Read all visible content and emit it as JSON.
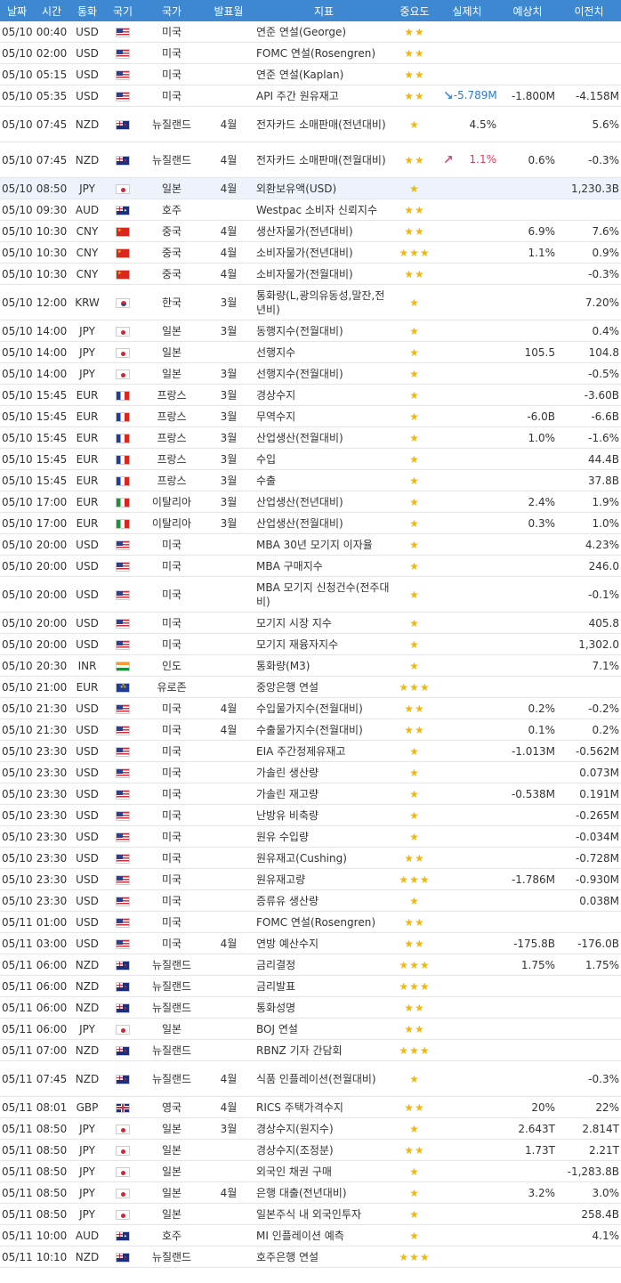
{
  "headers": [
    "날짜",
    "시간",
    "통화",
    "국기",
    "국가",
    "발표월",
    "지표",
    "중요도",
    "실제치",
    "예상치",
    "이전치"
  ],
  "rows": [
    {
      "date": "05/10",
      "time": "00:40",
      "cur": "USD",
      "flag": "us",
      "country": "미국",
      "month": "",
      "ind": "연준 연설(George)",
      "stars": "★★",
      "arrow": "",
      "actual": "",
      "actual_dir": "",
      "forecast": "",
      "prev": ""
    },
    {
      "date": "05/10",
      "time": "02:00",
      "cur": "USD",
      "flag": "us",
      "country": "미국",
      "month": "",
      "ind": "FOMC 연설(Rosengren)",
      "stars": "★★",
      "arrow": "",
      "actual": "",
      "actual_dir": "",
      "forecast": "",
      "prev": ""
    },
    {
      "date": "05/10",
      "time": "05:15",
      "cur": "USD",
      "flag": "us",
      "country": "미국",
      "month": "",
      "ind": "연준 연설(Kaplan)",
      "stars": "★★",
      "arrow": "",
      "actual": "",
      "actual_dir": "",
      "forecast": "",
      "prev": ""
    },
    {
      "date": "05/10",
      "time": "05:35",
      "cur": "USD",
      "flag": "us",
      "country": "미국",
      "month": "",
      "ind": "API 주간 원유재고",
      "stars": "★★",
      "arrow": "down",
      "actual": "-5.789M",
      "actual_dir": "neg",
      "forecast": "-1.800M",
      "prev": "-4.158M"
    },
    {
      "date": "05/10",
      "time": "07:45",
      "cur": "NZD",
      "flag": "nz",
      "country": "뉴질랜드",
      "month": "4월",
      "ind": "전자카드 소매판매(전년대비)",
      "stars": "★",
      "arrow": "",
      "actual": "4.5%",
      "actual_dir": "",
      "forecast": "",
      "prev": "5.6%",
      "tall": true
    },
    {
      "date": "05/10",
      "time": "07:45",
      "cur": "NZD",
      "flag": "nz",
      "country": "뉴질랜드",
      "month": "4월",
      "ind": "전자카드 소매판매(전월대비)",
      "stars": "★★",
      "arrow": "up",
      "actual": "1.1%",
      "actual_dir": "pos",
      "forecast": "0.6%",
      "prev": "-0.3%",
      "tall": true
    },
    {
      "date": "05/10",
      "time": "08:50",
      "cur": "JPY",
      "flag": "jp",
      "country": "일본",
      "month": "4월",
      "ind": "외환보유액(USD)",
      "stars": "★",
      "arrow": "",
      "actual": "",
      "actual_dir": "",
      "forecast": "",
      "prev": "1,230.3B",
      "hl": true
    },
    {
      "date": "05/10",
      "time": "09:30",
      "cur": "AUD",
      "flag": "au",
      "country": "호주",
      "month": "",
      "ind": "Westpac 소비자 신뢰지수",
      "stars": "★★",
      "arrow": "",
      "actual": "",
      "actual_dir": "",
      "forecast": "",
      "prev": ""
    },
    {
      "date": "05/10",
      "time": "10:30",
      "cur": "CNY",
      "flag": "cn",
      "country": "중국",
      "month": "4월",
      "ind": "생산자물가(전년대비)",
      "stars": "★★",
      "arrow": "",
      "actual": "",
      "actual_dir": "",
      "forecast": "6.9%",
      "prev": "7.6%"
    },
    {
      "date": "05/10",
      "time": "10:30",
      "cur": "CNY",
      "flag": "cn",
      "country": "중국",
      "month": "4월",
      "ind": "소비자물가(전년대비)",
      "stars": "★★★",
      "arrow": "",
      "actual": "",
      "actual_dir": "",
      "forecast": "1.1%",
      "prev": "0.9%"
    },
    {
      "date": "05/10",
      "time": "10:30",
      "cur": "CNY",
      "flag": "cn",
      "country": "중국",
      "month": "4월",
      "ind": "소비자물가(전월대비)",
      "stars": "★★",
      "arrow": "",
      "actual": "",
      "actual_dir": "",
      "forecast": "",
      "prev": "-0.3%"
    },
    {
      "date": "05/10",
      "time": "12:00",
      "cur": "KRW",
      "flag": "kr",
      "country": "한국",
      "month": "3월",
      "ind": "통화량(L,광의유동성,말잔,전년비)",
      "stars": "★",
      "arrow": "",
      "actual": "",
      "actual_dir": "",
      "forecast": "",
      "prev": "7.20%",
      "tall": true
    },
    {
      "date": "05/10",
      "time": "14:00",
      "cur": "JPY",
      "flag": "jp",
      "country": "일본",
      "month": "3월",
      "ind": "동행지수(전월대비)",
      "stars": "★",
      "arrow": "",
      "actual": "",
      "actual_dir": "",
      "forecast": "",
      "prev": "0.4%"
    },
    {
      "date": "05/10",
      "time": "14:00",
      "cur": "JPY",
      "flag": "jp",
      "country": "일본",
      "month": "",
      "ind": "선행지수",
      "stars": "★",
      "arrow": "",
      "actual": "",
      "actual_dir": "",
      "forecast": "105.5",
      "prev": "104.8"
    },
    {
      "date": "05/10",
      "time": "14:00",
      "cur": "JPY",
      "flag": "jp",
      "country": "일본",
      "month": "3월",
      "ind": "선행지수(전월대비)",
      "stars": "★",
      "arrow": "",
      "actual": "",
      "actual_dir": "",
      "forecast": "",
      "prev": "-0.5%"
    },
    {
      "date": "05/10",
      "time": "15:45",
      "cur": "EUR",
      "flag": "fr",
      "country": "프랑스",
      "month": "3월",
      "ind": "경상수지",
      "stars": "★",
      "arrow": "",
      "actual": "",
      "actual_dir": "",
      "forecast": "",
      "prev": "-3.60B"
    },
    {
      "date": "05/10",
      "time": "15:45",
      "cur": "EUR",
      "flag": "fr",
      "country": "프랑스",
      "month": "3월",
      "ind": "무역수지",
      "stars": "★",
      "arrow": "",
      "actual": "",
      "actual_dir": "",
      "forecast": "-6.0B",
      "prev": "-6.6B"
    },
    {
      "date": "05/10",
      "time": "15:45",
      "cur": "EUR",
      "flag": "fr",
      "country": "프랑스",
      "month": "3월",
      "ind": "산업생산(전월대비)",
      "stars": "★",
      "arrow": "",
      "actual": "",
      "actual_dir": "",
      "forecast": "1.0%",
      "prev": "-1.6%"
    },
    {
      "date": "05/10",
      "time": "15:45",
      "cur": "EUR",
      "flag": "fr",
      "country": "프랑스",
      "month": "3월",
      "ind": "수입",
      "stars": "★",
      "arrow": "",
      "actual": "",
      "actual_dir": "",
      "forecast": "",
      "prev": "44.4B"
    },
    {
      "date": "05/10",
      "time": "15:45",
      "cur": "EUR",
      "flag": "fr",
      "country": "프랑스",
      "month": "3월",
      "ind": "수출",
      "stars": "★",
      "arrow": "",
      "actual": "",
      "actual_dir": "",
      "forecast": "",
      "prev": "37.8B"
    },
    {
      "date": "05/10",
      "time": "17:00",
      "cur": "EUR",
      "flag": "it",
      "country": "이탈리아",
      "month": "3월",
      "ind": "산업생산(전년대비)",
      "stars": "★",
      "arrow": "",
      "actual": "",
      "actual_dir": "",
      "forecast": "2.4%",
      "prev": "1.9%"
    },
    {
      "date": "05/10",
      "time": "17:00",
      "cur": "EUR",
      "flag": "it",
      "country": "이탈리아",
      "month": "3월",
      "ind": "산업생산(전월대비)",
      "stars": "★",
      "arrow": "",
      "actual": "",
      "actual_dir": "",
      "forecast": "0.3%",
      "prev": "1.0%"
    },
    {
      "date": "05/10",
      "time": "20:00",
      "cur": "USD",
      "flag": "us",
      "country": "미국",
      "month": "",
      "ind": "MBA 30년 모기지 이자율",
      "stars": "★",
      "arrow": "",
      "actual": "",
      "actual_dir": "",
      "forecast": "",
      "prev": "4.23%"
    },
    {
      "date": "05/10",
      "time": "20:00",
      "cur": "USD",
      "flag": "us",
      "country": "미국",
      "month": "",
      "ind": "MBA 구매지수",
      "stars": "★",
      "arrow": "",
      "actual": "",
      "actual_dir": "",
      "forecast": "",
      "prev": "246.0"
    },
    {
      "date": "05/10",
      "time": "20:00",
      "cur": "USD",
      "flag": "us",
      "country": "미국",
      "month": "",
      "ind": "MBA 모기지 신청건수(전주대비)",
      "stars": "★",
      "arrow": "",
      "actual": "",
      "actual_dir": "",
      "forecast": "",
      "prev": "-0.1%",
      "tall": true
    },
    {
      "date": "05/10",
      "time": "20:00",
      "cur": "USD",
      "flag": "us",
      "country": "미국",
      "month": "",
      "ind": "모기지 시장 지수",
      "stars": "★",
      "arrow": "",
      "actual": "",
      "actual_dir": "",
      "forecast": "",
      "prev": "405.8"
    },
    {
      "date": "05/10",
      "time": "20:00",
      "cur": "USD",
      "flag": "us",
      "country": "미국",
      "month": "",
      "ind": "모기지 재융자지수",
      "stars": "★",
      "arrow": "",
      "actual": "",
      "actual_dir": "",
      "forecast": "",
      "prev": "1,302.0"
    },
    {
      "date": "05/10",
      "time": "20:30",
      "cur": "INR",
      "flag": "in",
      "country": "인도",
      "month": "",
      "ind": "통화량(M3)",
      "stars": "★",
      "arrow": "",
      "actual": "",
      "actual_dir": "",
      "forecast": "",
      "prev": "7.1%"
    },
    {
      "date": "05/10",
      "time": "21:00",
      "cur": "EUR",
      "flag": "eu",
      "country": "유로존",
      "month": "",
      "ind": "중앙은행 연설",
      "stars": "★★★",
      "arrow": "",
      "actual": "",
      "actual_dir": "",
      "forecast": "",
      "prev": ""
    },
    {
      "date": "05/10",
      "time": "21:30",
      "cur": "USD",
      "flag": "us",
      "country": "미국",
      "month": "4월",
      "ind": "수입물가지수(전월대비)",
      "stars": "★★",
      "arrow": "",
      "actual": "",
      "actual_dir": "",
      "forecast": "0.2%",
      "prev": "-0.2%"
    },
    {
      "date": "05/10",
      "time": "21:30",
      "cur": "USD",
      "flag": "us",
      "country": "미국",
      "month": "4월",
      "ind": "수출물가지수(전월대비)",
      "stars": "★★",
      "arrow": "",
      "actual": "",
      "actual_dir": "",
      "forecast": "0.1%",
      "prev": "0.2%"
    },
    {
      "date": "05/10",
      "time": "23:30",
      "cur": "USD",
      "flag": "us",
      "country": "미국",
      "month": "",
      "ind": "EIA 주간정제유재고",
      "stars": "★",
      "arrow": "",
      "actual": "",
      "actual_dir": "",
      "forecast": "-1.013M",
      "prev": "-0.562M"
    },
    {
      "date": "05/10",
      "time": "23:30",
      "cur": "USD",
      "flag": "us",
      "country": "미국",
      "month": "",
      "ind": "가솔린 생산량",
      "stars": "★",
      "arrow": "",
      "actual": "",
      "actual_dir": "",
      "forecast": "",
      "prev": "0.073M"
    },
    {
      "date": "05/10",
      "time": "23:30",
      "cur": "USD",
      "flag": "us",
      "country": "미국",
      "month": "",
      "ind": "가솔린 재고량",
      "stars": "★",
      "arrow": "",
      "actual": "",
      "actual_dir": "",
      "forecast": "-0.538M",
      "prev": "0.191M"
    },
    {
      "date": "05/10",
      "time": "23:30",
      "cur": "USD",
      "flag": "us",
      "country": "미국",
      "month": "",
      "ind": "난방유 비축량",
      "stars": "★",
      "arrow": "",
      "actual": "",
      "actual_dir": "",
      "forecast": "",
      "prev": "-0.265M"
    },
    {
      "date": "05/10",
      "time": "23:30",
      "cur": "USD",
      "flag": "us",
      "country": "미국",
      "month": "",
      "ind": "원유 수입량",
      "stars": "★",
      "arrow": "",
      "actual": "",
      "actual_dir": "",
      "forecast": "",
      "prev": "-0.034M"
    },
    {
      "date": "05/10",
      "time": "23:30",
      "cur": "USD",
      "flag": "us",
      "country": "미국",
      "month": "",
      "ind": "원유재고(Cushing)",
      "stars": "★★",
      "arrow": "",
      "actual": "",
      "actual_dir": "",
      "forecast": "",
      "prev": "-0.728M"
    },
    {
      "date": "05/10",
      "time": "23:30",
      "cur": "USD",
      "flag": "us",
      "country": "미국",
      "month": "",
      "ind": "원유재고량",
      "stars": "★★★",
      "arrow": "",
      "actual": "",
      "actual_dir": "",
      "forecast": "-1.786M",
      "prev": "-0.930M"
    },
    {
      "date": "05/10",
      "time": "23:30",
      "cur": "USD",
      "flag": "us",
      "country": "미국",
      "month": "",
      "ind": "증류유 생산량",
      "stars": "★",
      "arrow": "",
      "actual": "",
      "actual_dir": "",
      "forecast": "",
      "prev": "0.038M"
    },
    {
      "date": "05/11",
      "time": "01:00",
      "cur": "USD",
      "flag": "us",
      "country": "미국",
      "month": "",
      "ind": "FOMC 연설(Rosengren)",
      "stars": "★★",
      "arrow": "",
      "actual": "",
      "actual_dir": "",
      "forecast": "",
      "prev": ""
    },
    {
      "date": "05/11",
      "time": "03:00",
      "cur": "USD",
      "flag": "us",
      "country": "미국",
      "month": "4월",
      "ind": "연방 예산수지",
      "stars": "★★",
      "arrow": "",
      "actual": "",
      "actual_dir": "",
      "forecast": "-175.8B",
      "prev": "-176.0B"
    },
    {
      "date": "05/11",
      "time": "06:00",
      "cur": "NZD",
      "flag": "nz",
      "country": "뉴질랜드",
      "month": "",
      "ind": "금리결정",
      "stars": "★★★",
      "arrow": "",
      "actual": "",
      "actual_dir": "",
      "forecast": "1.75%",
      "prev": "1.75%"
    },
    {
      "date": "05/11",
      "time": "06:00",
      "cur": "NZD",
      "flag": "nz",
      "country": "뉴질랜드",
      "month": "",
      "ind": "금리발표",
      "stars": "★★★",
      "arrow": "",
      "actual": "",
      "actual_dir": "",
      "forecast": "",
      "prev": ""
    },
    {
      "date": "05/11",
      "time": "06:00",
      "cur": "NZD",
      "flag": "nz",
      "country": "뉴질랜드",
      "month": "",
      "ind": "통화성명",
      "stars": "★★",
      "arrow": "",
      "actual": "",
      "actual_dir": "",
      "forecast": "",
      "prev": ""
    },
    {
      "date": "05/11",
      "time": "06:00",
      "cur": "JPY",
      "flag": "jp",
      "country": "일본",
      "month": "",
      "ind": "BOJ 연설",
      "stars": "★★",
      "arrow": "",
      "actual": "",
      "actual_dir": "",
      "forecast": "",
      "prev": ""
    },
    {
      "date": "05/11",
      "time": "07:00",
      "cur": "NZD",
      "flag": "nz",
      "country": "뉴질랜드",
      "month": "",
      "ind": "RBNZ 기자 간담회",
      "stars": "★★★",
      "arrow": "",
      "actual": "",
      "actual_dir": "",
      "forecast": "",
      "prev": ""
    },
    {
      "date": "05/11",
      "time": "07:45",
      "cur": "NZD",
      "flag": "nz",
      "country": "뉴질랜드",
      "month": "4월",
      "ind": "식품 인플레이션(전월대비)",
      "stars": "★",
      "arrow": "",
      "actual": "",
      "actual_dir": "",
      "forecast": "",
      "prev": "-0.3%",
      "tall": true
    },
    {
      "date": "05/11",
      "time": "08:01",
      "cur": "GBP",
      "flag": "gb",
      "country": "영국",
      "month": "4월",
      "ind": "RICS 주택가격수지",
      "stars": "★★",
      "arrow": "",
      "actual": "",
      "actual_dir": "",
      "forecast": "20%",
      "prev": "22%"
    },
    {
      "date": "05/11",
      "time": "08:50",
      "cur": "JPY",
      "flag": "jp",
      "country": "일본",
      "month": "3월",
      "ind": "경상수지(원지수)",
      "stars": "★",
      "arrow": "",
      "actual": "",
      "actual_dir": "",
      "forecast": "2.643T",
      "prev": "2.814T"
    },
    {
      "date": "05/11",
      "time": "08:50",
      "cur": "JPY",
      "flag": "jp",
      "country": "일본",
      "month": "",
      "ind": "경상수지(조정분)",
      "stars": "★★",
      "arrow": "",
      "actual": "",
      "actual_dir": "",
      "forecast": "1.73T",
      "prev": "2.21T"
    },
    {
      "date": "05/11",
      "time": "08:50",
      "cur": "JPY",
      "flag": "jp",
      "country": "일본",
      "month": "",
      "ind": "외국인 채권 구매",
      "stars": "★",
      "arrow": "",
      "actual": "",
      "actual_dir": "",
      "forecast": "",
      "prev": "-1,283.8B"
    },
    {
      "date": "05/11",
      "time": "08:50",
      "cur": "JPY",
      "flag": "jp",
      "country": "일본",
      "month": "4월",
      "ind": "은행 대출(전년대비)",
      "stars": "★",
      "arrow": "",
      "actual": "",
      "actual_dir": "",
      "forecast": "3.2%",
      "prev": "3.0%"
    },
    {
      "date": "05/11",
      "time": "08:50",
      "cur": "JPY",
      "flag": "jp",
      "country": "일본",
      "month": "",
      "ind": "일본주식 내 외국인투자",
      "stars": "★",
      "arrow": "",
      "actual": "",
      "actual_dir": "",
      "forecast": "",
      "prev": "258.4B"
    },
    {
      "date": "05/11",
      "time": "10:00",
      "cur": "AUD",
      "flag": "au",
      "country": "호주",
      "month": "",
      "ind": "MI 인플레이션 예측",
      "stars": "★",
      "arrow": "",
      "actual": "",
      "actual_dir": "",
      "forecast": "",
      "prev": "4.1%"
    },
    {
      "date": "05/11",
      "time": "10:10",
      "cur": "NZD",
      "flag": "nz",
      "country": "뉴질랜드",
      "month": "",
      "ind": "호주은행 연설",
      "stars": "★★★",
      "arrow": "",
      "actual": "",
      "actual_dir": "",
      "forecast": "",
      "prev": ""
    }
  ]
}
